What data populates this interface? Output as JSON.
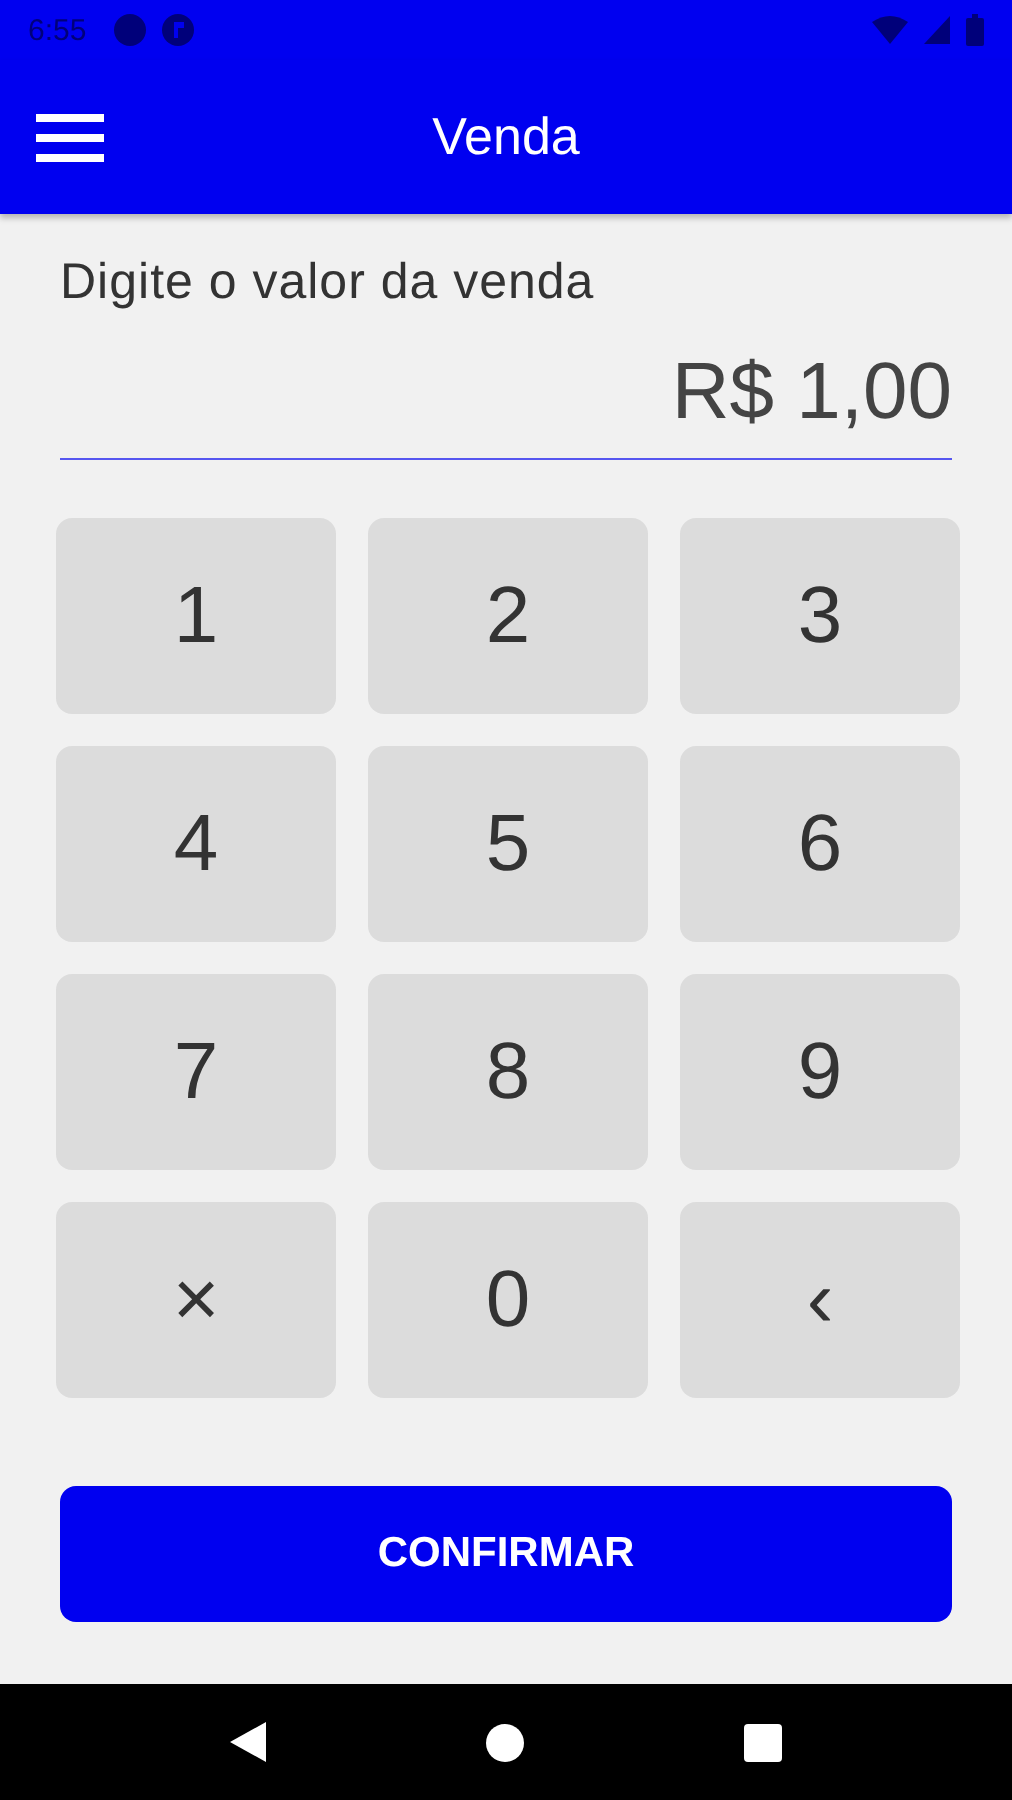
{
  "status_bar": {
    "time": "6:55"
  },
  "app_bar": {
    "title": "Venda"
  },
  "amount_field": {
    "label": "Digite o valor da venda",
    "value": "R$ 1,00"
  },
  "keypad": [
    {
      "label": "1"
    },
    {
      "label": "2"
    },
    {
      "label": "3"
    },
    {
      "label": "4"
    },
    {
      "label": "5"
    },
    {
      "label": "6"
    },
    {
      "label": "7"
    },
    {
      "label": "8"
    },
    {
      "label": "9"
    },
    {
      "label": "×"
    },
    {
      "label": "0"
    },
    {
      "label": "‹"
    }
  ],
  "confirm_button": {
    "label": "CONFIRMAR"
  }
}
